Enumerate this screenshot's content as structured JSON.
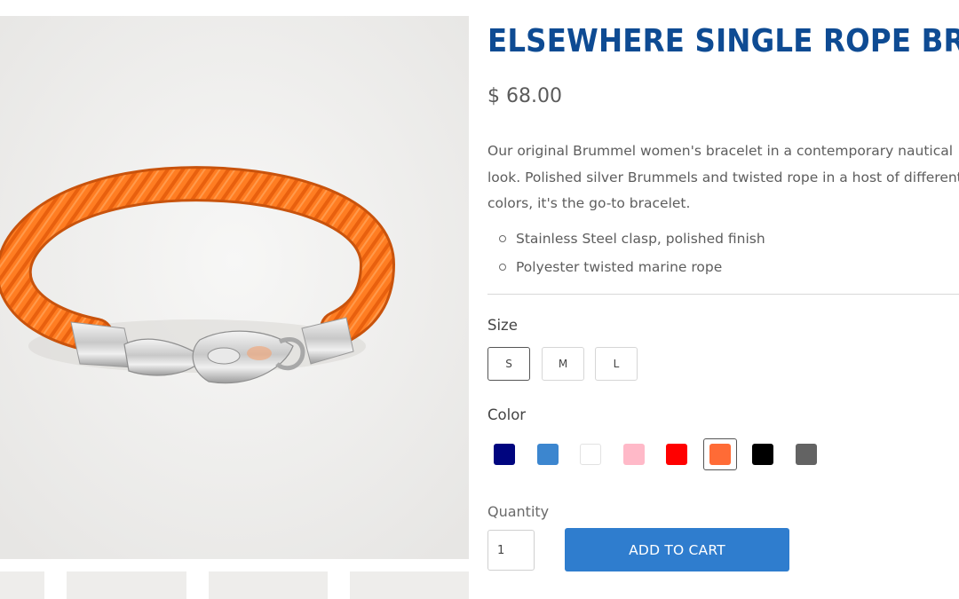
{
  "product": {
    "title": "ELSEWHERE SINGLE ROPE BRACELET",
    "price": "$ 68.00",
    "description": "Our original Brummel women's bracelet in a contemporary nautical look. Polished silver Brummels and twisted rope in a host of different colors, it's the go-to bracelet.",
    "features": [
      "Stainless Steel clasp, polished finish",
      "Polyester twisted marine rope"
    ],
    "image_colors": {
      "rope": "#ff7d22",
      "background": "#eeedeb"
    }
  },
  "options": {
    "size": {
      "label": "Size",
      "values": [
        "S",
        "M",
        "L"
      ],
      "selected": "S"
    },
    "color": {
      "label": "Color",
      "swatches": [
        {
          "name": "navy",
          "hex": "#00057f"
        },
        {
          "name": "blue",
          "hex": "#3c86cf"
        },
        {
          "name": "white",
          "hex": "#ffffff"
        },
        {
          "name": "pink",
          "hex": "#ffb9c8"
        },
        {
          "name": "red",
          "hex": "#ff0000"
        },
        {
          "name": "orange",
          "hex": "#ff6b36"
        },
        {
          "name": "black",
          "hex": "#000000"
        },
        {
          "name": "grey",
          "hex": "#636363"
        }
      ],
      "selected": "orange"
    }
  },
  "purchase": {
    "quantity_label": "Quantity",
    "quantity_value": "1",
    "add_to_cart_label": "ADD TO CART",
    "button_color": "#2f7dce"
  }
}
